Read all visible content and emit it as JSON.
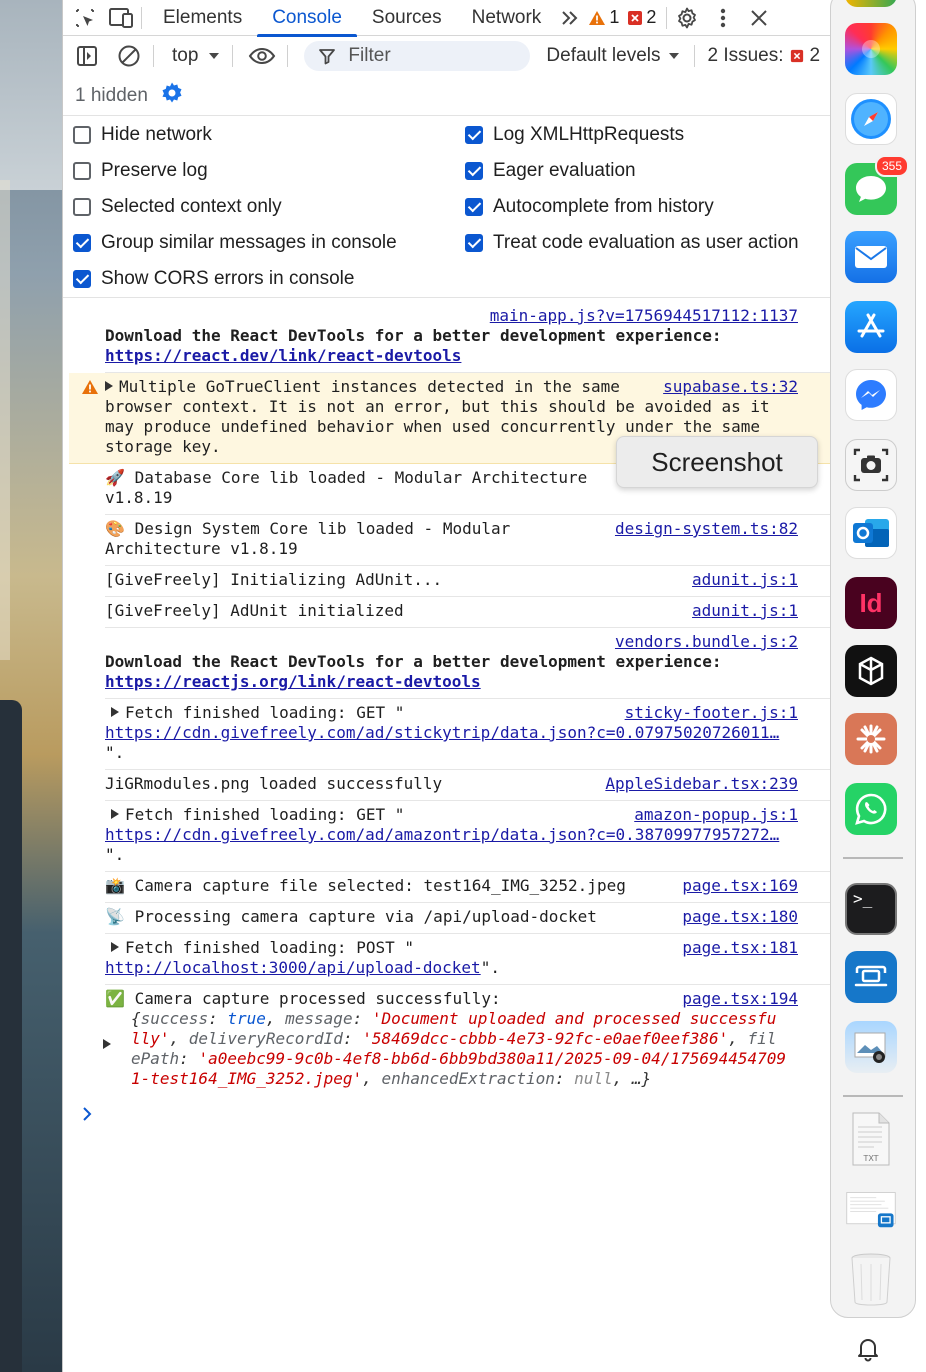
{
  "tabs": {
    "elements": "Elements",
    "console": "Console",
    "sources": "Sources",
    "network": "Network",
    "warn_count": "1",
    "error_count": "2"
  },
  "toolbar": {
    "context": "top",
    "filter_placeholder": "Filter",
    "levels": "Default levels",
    "issues_label": "2 Issues:",
    "issues_count": "2",
    "hidden": "1 hidden"
  },
  "settings": {
    "hide_network": "Hide network",
    "preserve_log": "Preserve log",
    "selected_context": "Selected context only",
    "group_similar": "Group similar messages in console",
    "show_cors": "Show CORS errors in console",
    "log_xhr": "Log XMLHttpRequests",
    "eager_eval": "Eager evaluation",
    "autocomplete": "Autocomplete from history",
    "treat_code": "Treat code evaluation as user action"
  },
  "messages": {
    "m1": {
      "src": "main-app.js?v=1756944517112:1137",
      "text": "Download the React DevTools for a better development experience:",
      "link": "https://react.dev/link/react-devtools"
    },
    "m2": {
      "src": "supabase.ts:32",
      "line1": "Multiple GoTrueClient instances detected in the same",
      "line2": "browser context. It is not an error, but this should be avoided as it",
      "line3": "may produce undefined behavior when used concurrently under the same",
      "line4": "storage key."
    },
    "m3": {
      "icon": "🚀",
      "line1": "Database Core lib loaded - Modular Architecture",
      "line2": "v1.8.19"
    },
    "m4": {
      "icon": "🎨",
      "src": "design-system.ts:82",
      "line1": "Design System Core lib loaded - Modular",
      "line2": "Architecture v1.8.19"
    },
    "m5": {
      "src": "adunit.js:1",
      "text": "[GiveFreely] Initializing AdUnit..."
    },
    "m6": {
      "src": "adunit.js:1",
      "text": "[GiveFreely] AdUnit initialized"
    },
    "m7": {
      "src": "vendors.bundle.js:2",
      "text": "Download the React DevTools for a better development experience:",
      "link": "https://reactjs.org/link/react-devtools"
    },
    "m8": {
      "src": "sticky-footer.js:1",
      "text": "Fetch finished loading: GET \"",
      "link": "https://cdn.givefreely.com/ad/stickytrip/data.json?c=0.07975020726011…",
      "tail": "\"."
    },
    "m9": {
      "src": "AppleSidebar.tsx:239",
      "text": "JiGRmodules.png loaded successfully"
    },
    "m10": {
      "src": "amazon-popup.js:1",
      "text": "Fetch finished loading: GET \"",
      "link": "https://cdn.givefreely.com/ad/amazontrip/data.json?c=0.38709977957272…",
      "tail": "\"."
    },
    "m11": {
      "icon": "📸",
      "src": "page.tsx:169",
      "text": "Camera capture file selected: test164_IMG_3252.jpeg"
    },
    "m12": {
      "icon": "📡",
      "src": "page.tsx:180",
      "text": "Processing camera capture via /api/upload-docket"
    },
    "m13": {
      "src": "page.tsx:181",
      "text": "Fetch finished loading: POST \"",
      "link": "http://localhost:3000/api/upload-docket",
      "tail": "\"."
    },
    "m14": {
      "icon": "✅",
      "src": "page.tsx:194",
      "text": "Camera capture processed successfully:",
      "o1": "{",
      "k_success": "success",
      "v_success": "true",
      "k_message": "message",
      "v_message_a": "'Document uploaded and processed successfu",
      "v_message_b": "lly'",
      "k_delivery": "deliveryRecordId",
      "v_delivery": "'58469dcc-cbbb-4e73-92fc-e0aef0eef386'",
      "k_file_a": "fil",
      "k_file_b": "ePath",
      "v_file_a": "'a0eebc99-9c0b-4ef8-bb6d-6bb9bd380a11/2025-09-04/175694454709",
      "v_file_b": "1-test164_IMG_3252.jpeg'",
      "k_enh": "enhancedExtraction",
      "v_enh": "null",
      "o2": "…}"
    }
  },
  "tooltip": "Screenshot",
  "dock": {
    "messages_badge": "355"
  }
}
